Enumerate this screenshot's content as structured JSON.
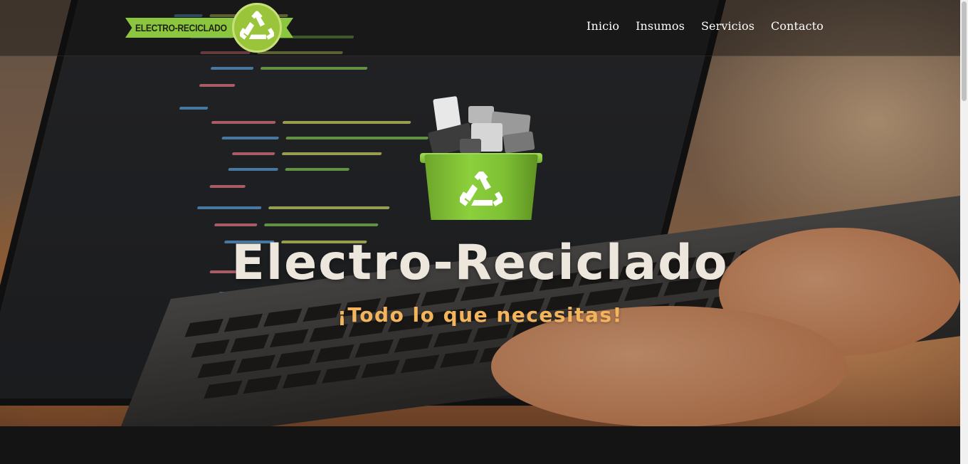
{
  "navbar": {
    "logo_text": "ELECTRO-RECICLADO",
    "links": [
      {
        "label": "Inicio"
      },
      {
        "label": "Insumos"
      },
      {
        "label": "Servicios"
      },
      {
        "label": "Contacto"
      }
    ]
  },
  "hero": {
    "title": "Electro-Reciclado",
    "subtitle": "¡Todo lo que necesitas!",
    "image_icon": "recycle-bin-with-electronics-icon"
  },
  "colors": {
    "accent_green": "#8cc63f",
    "subtitle_orange": "#f4b45c",
    "title_cream": "#ece6dc",
    "dark_section": "#141414"
  }
}
